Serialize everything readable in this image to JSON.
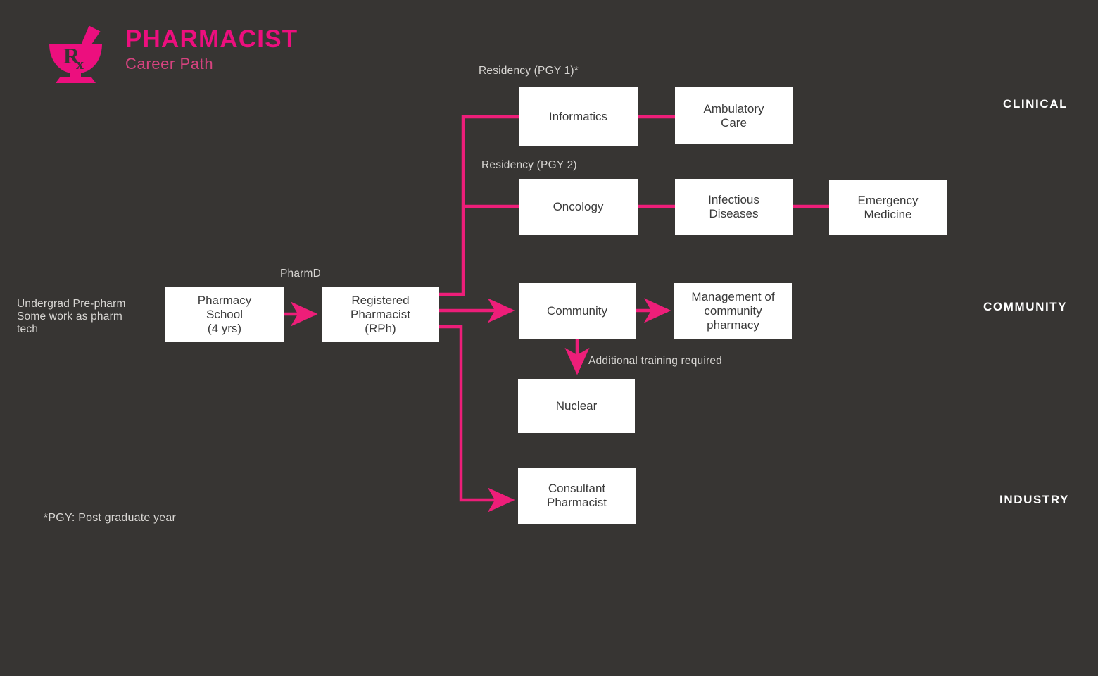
{
  "page": {
    "background_color": "#373533",
    "accent_color": "#ED1E79",
    "node_fill": "#FFFFFF",
    "node_text_color": "#3A3A3A",
    "label_color": "#D8D6D3",
    "lane_label_color": "#FFFFFF"
  },
  "logo": {
    "icon": "mortar-and-pestle-rx-icon",
    "rx_text": "Rx",
    "title": "PHARMACIST",
    "subtitle": "Career Path"
  },
  "lanes": [
    {
      "id": "clinical",
      "label": "CLINICAL"
    },
    {
      "id": "community",
      "label": "COMMUNITY"
    },
    {
      "id": "industry",
      "label": "INDUSTRY"
    }
  ],
  "stage_labels": {
    "residency_pgy1": "Residency (PGY 1)*",
    "residency_pgy2": "Residency (PGY 2)",
    "pharmd": "PharmD",
    "additional_training": "Additional training required",
    "entry_note": "Undergrad Pre-pharm\nSome work as pharm\ntech"
  },
  "nodes": [
    {
      "id": "pharmacy-school",
      "label": "Pharmacy\nSchool\n(4 yrs)"
    },
    {
      "id": "registered-pharmacist",
      "label": "Registered\nPharmacist\n(RPh)"
    },
    {
      "id": "informatics",
      "label": "Informatics"
    },
    {
      "id": "ambulatory-care",
      "label": "Ambulatory\nCare"
    },
    {
      "id": "oncology",
      "label": "Oncology"
    },
    {
      "id": "infectious-diseases",
      "label": "Infectious\nDiseases"
    },
    {
      "id": "emergency-medicine",
      "label": "Emergency\nMedicine"
    },
    {
      "id": "community",
      "label": "Community"
    },
    {
      "id": "management-community-pharmacy",
      "label": "Management of\ncommunity\npharmacy"
    },
    {
      "id": "nuclear",
      "label": "Nuclear"
    },
    {
      "id": "consultant-pharmacist",
      "label": "Consultant\nPharmacist"
    }
  ],
  "footnote": "*PGY: Post graduate year"
}
